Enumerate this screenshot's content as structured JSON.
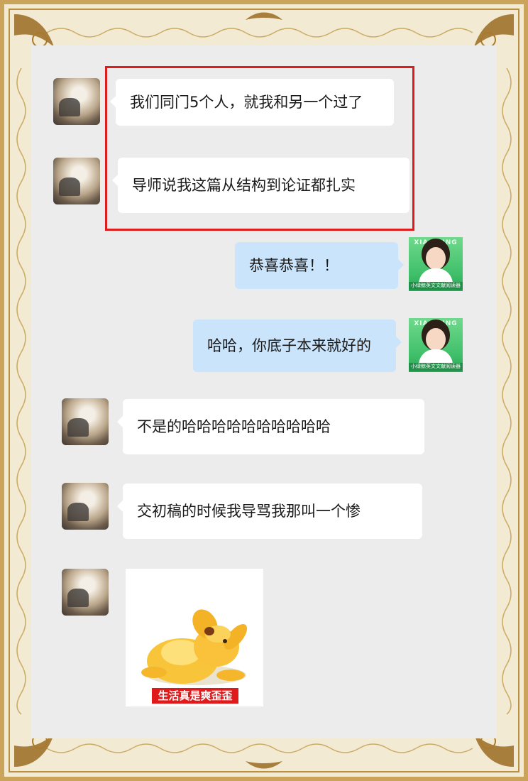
{
  "messages": [
    {
      "side": "left",
      "text": "我们同门5个人，就我和另一个过了"
    },
    {
      "side": "left",
      "text": "导师说我这篇从结构到论证都扎实"
    },
    {
      "side": "right",
      "text": "恭喜恭喜！！"
    },
    {
      "side": "right",
      "text": "哈哈，你底子本来就好的"
    },
    {
      "side": "left",
      "text": "不是的哈哈哈哈哈哈哈哈哈哈"
    },
    {
      "side": "left",
      "text": "交初稿的时候我导骂我那叫一个惨"
    }
  ],
  "sticker": {
    "caption": "生活真是爽歪歪",
    "icon": "yellow-dog-sticker"
  },
  "my_avatar": {
    "brand": "XIAOYUNG",
    "caption": "小绿鲸英文文献阅读器"
  },
  "colors": {
    "highlight_box": "#e01b1b",
    "my_bubble": "#c9e4fb",
    "their_bubble": "#ffffff",
    "chat_background": "#ececec",
    "frame_gold": "#c9a45a"
  }
}
